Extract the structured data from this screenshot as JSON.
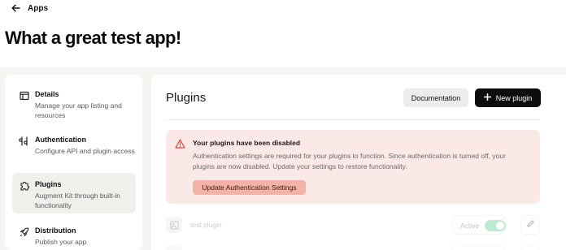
{
  "header": {
    "back_label": "Apps",
    "title": "What a great test app!"
  },
  "sidebar": {
    "items": [
      {
        "title": "Details",
        "description": "Manage your app listing and resources",
        "icon": "details-icon",
        "active": false
      },
      {
        "title": "Authentication",
        "description": "Configure API and plugin access",
        "icon": "authentication-icon",
        "active": false
      },
      {
        "title": "Plugins",
        "description": "Augment Kit through built-in functionality",
        "icon": "puzzle-icon",
        "active": true
      },
      {
        "title": "Distribution",
        "description": "Publish your app",
        "icon": "rocket-icon",
        "active": false
      }
    ]
  },
  "main": {
    "title": "Plugins",
    "documentation_label": "Documentation",
    "new_plugin_label": "New plugin",
    "alert": {
      "title": "Your plugins have been disabled",
      "body": "Authentication settings are required for your plugins to function. Since authentication is turned off, your plugins are now disabled. Update your settings to restore functionality.",
      "button_label": "Update Authentication Settings"
    },
    "plugins": [
      {
        "name": "test plugin",
        "status_label": "Active",
        "enabled": true
      }
    ]
  },
  "colors": {
    "accent": "#0d0d0d",
    "alert_bg": "#fbe9e7",
    "alert_button": "#f4b2a6",
    "alert_icon": "#d9483a",
    "toggle_on": "#6fd39a",
    "canvas": "#f7f5f2"
  }
}
